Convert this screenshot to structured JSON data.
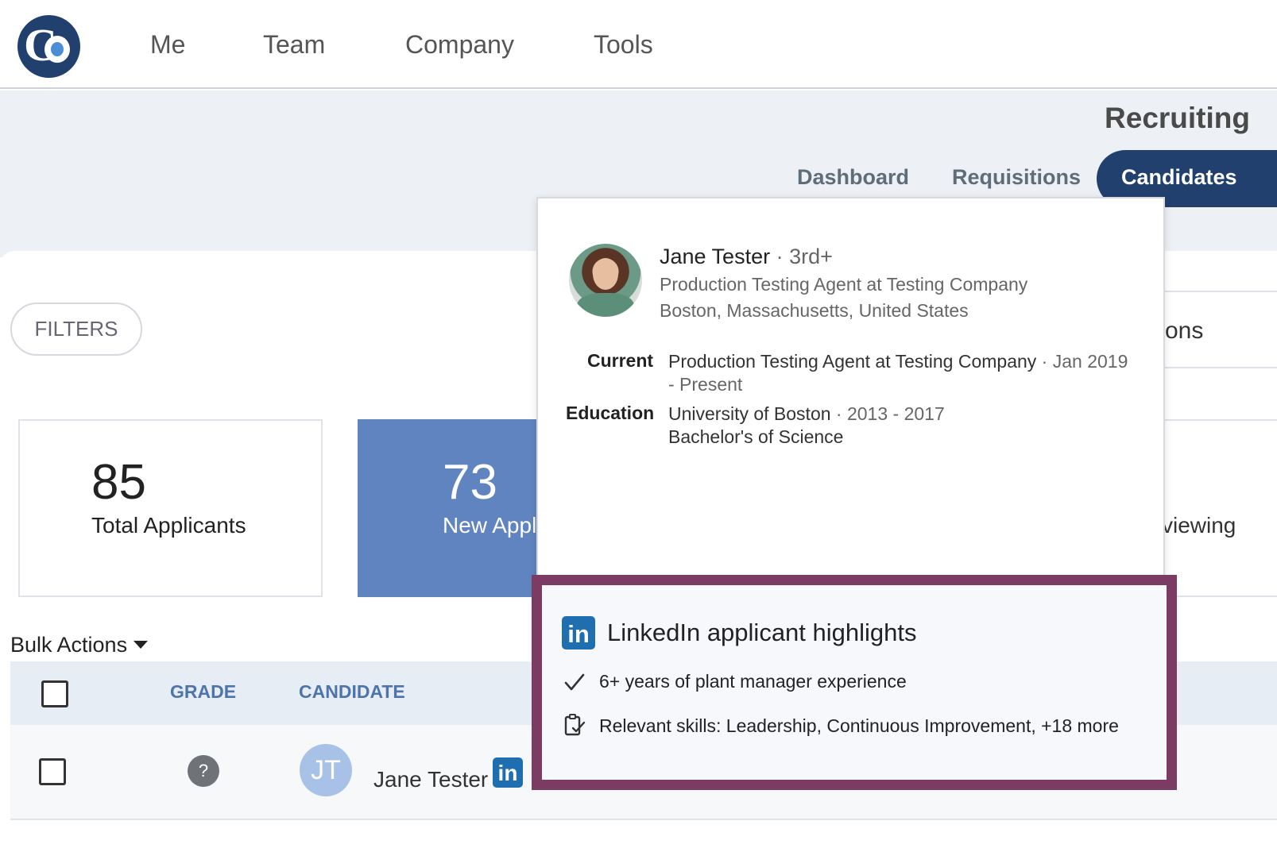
{
  "nav": {
    "items": [
      "Me",
      "Team",
      "Company",
      "Tools"
    ]
  },
  "header": {
    "section_title": "Recruiting",
    "tabs": [
      "Dashboard",
      "Requisitions",
      "Candidates"
    ],
    "active_tab": "Candidates"
  },
  "filters_label": "FILTERS",
  "stats": [
    {
      "value": "85",
      "label": "Total Applicants"
    },
    {
      "value": "73",
      "label": "New Appl"
    }
  ],
  "right_fragments": {
    "tab_fragment": "ons",
    "stat_fragment": "viewing"
  },
  "bulk_actions": "Bulk Actions",
  "table": {
    "headers": [
      "GRADE",
      "CANDIDATE"
    ],
    "rows": [
      {
        "grade": "?",
        "initials": "JT",
        "name": "Jane Tester"
      }
    ]
  },
  "profile": {
    "name": "Jane Tester",
    "degree": "· 3rd+",
    "headline": "Production Testing Agent at Testing Company",
    "location": "Boston, Massachusetts, United States",
    "current_label": "Current",
    "current_role": "Production Testing Agent at Testing Company",
    "current_dates": "· Jan 2019 - Present",
    "education_label": "Education",
    "school": "University of Boston",
    "school_dates": "· 2013 - 2017",
    "degree_name": "Bachelor's of Science"
  },
  "highlights": {
    "title": "LinkedIn applicant highlights",
    "items": [
      "6+ years of plant manager experience",
      "Relevant skills: Leadership, Continuous Improvement, +18 more"
    ]
  },
  "icons": {
    "linkedin_glyph": "in"
  },
  "colors": {
    "brand_navy": "#22406e",
    "accent_blue": "#6084bf",
    "highlight_border": "#7b3b62",
    "linkedin": "#1f6fb0"
  }
}
